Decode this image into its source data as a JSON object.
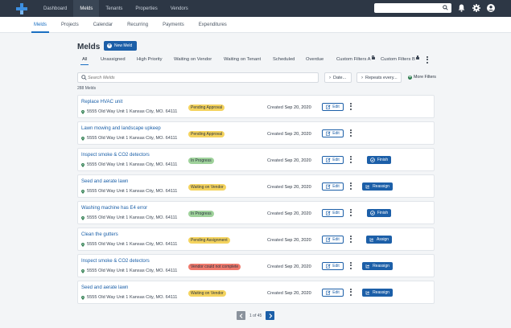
{
  "topnav": [
    "Dashboard",
    "Melds",
    "Tenants",
    "Properties",
    "Vendors"
  ],
  "subnav": [
    "Melds",
    "Projects",
    "Calendar",
    "Recurring",
    "Payments",
    "Expenditures"
  ],
  "page_title": "Melds",
  "new_meld_label": "New Meld",
  "filter_tabs": [
    "All",
    "Unassigned",
    "High Priority",
    "Waiting on Vendor",
    "Waiting on Tenant",
    "Scheduled",
    "Overdue",
    "Custom Filters A",
    "Custom Filters B"
  ],
  "search_placeholder": "Search Melds",
  "date_filter_label": "Date...",
  "repeats_filter_label": "Repeats every...",
  "more_filters_label": "More Filters",
  "result_count": "288 Melds",
  "created_prefix": "Created",
  "edit_label": "Edit",
  "colors": {
    "pending": "#f4d35e",
    "in_progress": "#9fd29b",
    "vendor_error": "#ef7a6d",
    "primary": "#1c5fa8"
  },
  "melds": [
    {
      "title": "Replace HVAC unit",
      "address": "5555 Old Way Unit 1 Kansas City, MO. 64111",
      "status": "Pending Approval",
      "status_color": "#f4d35e",
      "created": "Sep 20, 2020",
      "action": ""
    },
    {
      "title": "Lawn mowing and landscape upkeep",
      "address": "5555 Old Way Unit 1 Kansas City, MO. 64111",
      "status": "Pending Approval",
      "status_color": "#f4d35e",
      "created": "Sep 20, 2020",
      "action": ""
    },
    {
      "title": "Inspect smoke & CO2 detectors",
      "address": "5555 Old Way Unit 1 Kansas City, MO. 64111",
      "status": "In Progress",
      "status_color": "#9fd29b",
      "created": "Sep 20, 2020",
      "action": "Finish"
    },
    {
      "title": "Seed and aerate lawn",
      "address": "5555 Old Way Unit 1 Kansas City, MO. 64111",
      "status": "Waiting on Vendor",
      "status_color": "#f4d35e",
      "created": "Sep 20, 2020",
      "action": "Reassign"
    },
    {
      "title": "Washing machine has E4 error",
      "address": "5555 Old Way Unit 1 Kansas City, MO. 64111",
      "status": "In Progress",
      "status_color": "#9fd29b",
      "created": "Sep 20, 2020",
      "action": "Finish"
    },
    {
      "title": "Clean the gutters",
      "address": "5555 Old Way Unit 1 Kansas City, MO. 64111",
      "status": "Pending Assignment",
      "status_color": "#f4d35e",
      "created": "Sep 20, 2020",
      "action": "Assign"
    },
    {
      "title": "Inspect smoke & CO2 detectors",
      "address": "5555 Old Way Unit 1 Kansas City, MO. 64111",
      "status": "Vendor could not complete",
      "status_color": "#ef7a6d",
      "created": "Sep 20, 2020",
      "action": "Reassign"
    },
    {
      "title": "Seed and aerate lawn",
      "address": "5555 Old Way Unit 1 Kansas City, MO. 64111",
      "status": "Waiting on Vendor",
      "status_color": "#f4d35e",
      "created": "Sep 20, 2020",
      "action": "Reassign"
    }
  ],
  "pagination": {
    "current": 1,
    "total": 45,
    "text": "1 of 45"
  }
}
